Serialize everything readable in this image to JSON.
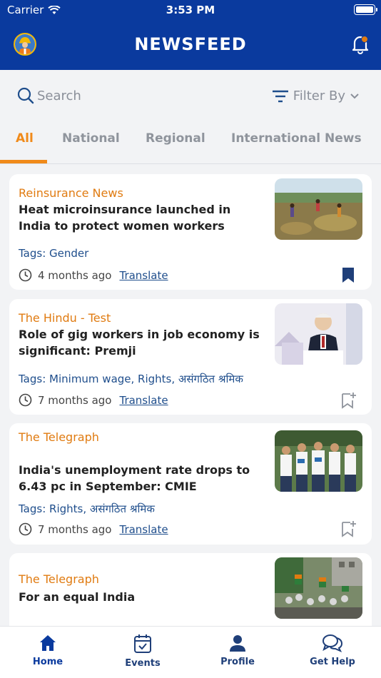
{
  "status": {
    "carrier": "Carrier",
    "time": "3:53 PM"
  },
  "header": {
    "title": "NEWSFEED"
  },
  "search": {
    "placeholder": "Search",
    "filter_label": "Filter By"
  },
  "tabs": [
    "All",
    "National",
    "Regional",
    "International News"
  ],
  "active_tab": "All",
  "articles": [
    {
      "source": "Reinsurance News",
      "title": "Heat microinsurance launched in India to protect women workers",
      "tags": "Tags: Gender",
      "time": "4 months ago",
      "translate": "Translate",
      "bookmarked": true
    },
    {
      "source": "The Hindu - Test",
      "title": "Role of gig workers in job economy is significant: Premji",
      "tags": "Tags: Minimum wage, Rights, असंगठित श्रमिक",
      "time": "7 months ago",
      "translate": "Translate",
      "bookmarked": false
    },
    {
      "source": "The Telegraph",
      "title": "India's unemployment rate drops to 6.43 pc in September: CMIE",
      "tags": "Tags: Rights, असंगठित श्रमिक",
      "time": "7 months ago",
      "translate": "Translate",
      "bookmarked": false
    },
    {
      "source": "The Telegraph",
      "title": "For an equal India"
    }
  ],
  "bottom_nav": [
    {
      "label": "Home",
      "icon": "home-icon",
      "active": true
    },
    {
      "label": "Events",
      "icon": "calendar-icon",
      "active": false
    },
    {
      "label": "Profile",
      "icon": "person-icon",
      "active": false
    },
    {
      "label": "Get Help",
      "icon": "chat-icon",
      "active": false
    }
  ],
  "colors": {
    "brand": "#0a3a9e",
    "accent": "#f08a1a",
    "source": "#e07b11",
    "tag": "#1f4e8c"
  }
}
